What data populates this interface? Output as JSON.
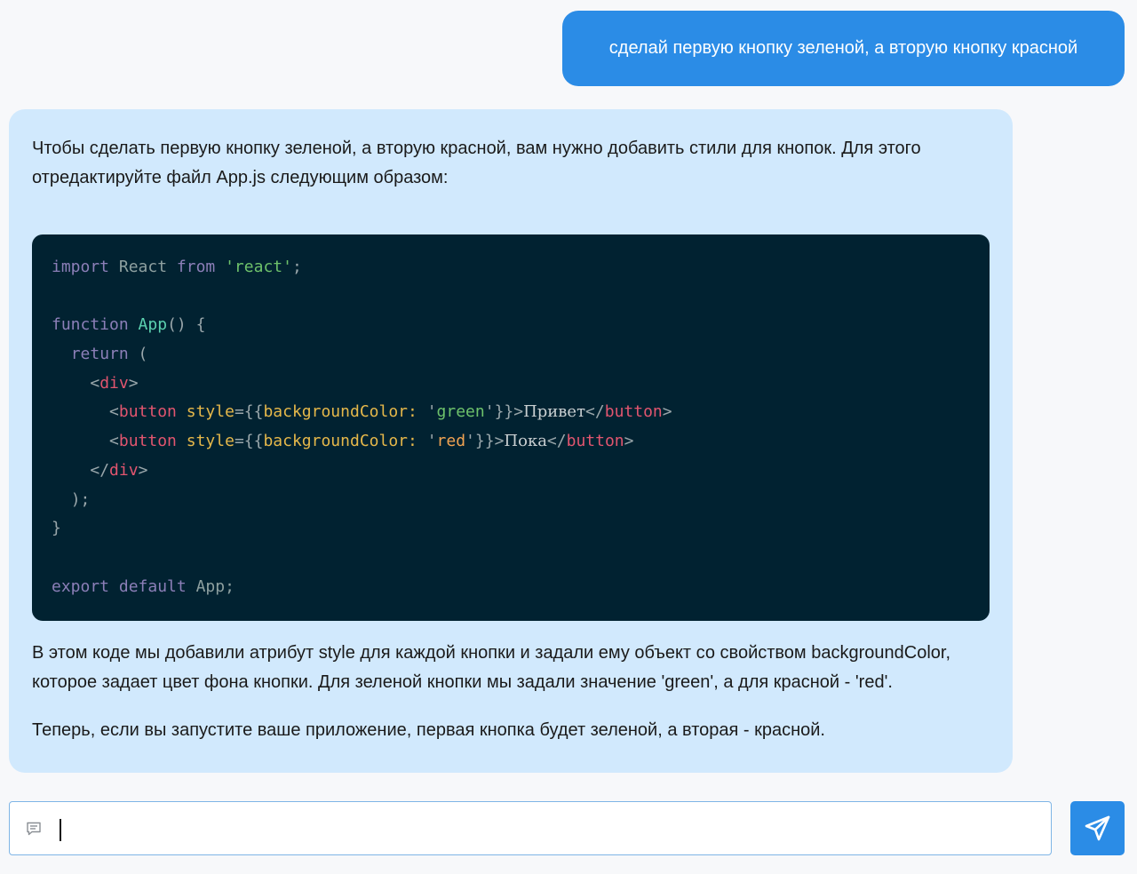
{
  "conversation": {
    "user_message": "сделай первую кнопку зеленой, а вторую кнопку красной",
    "assistant": {
      "intro": "Чтобы сделать первую кнопку зеленой, а вторую красной, вам нужно добавить стили для кнопок. Для этого отредактируйте файл App.js следующим образом:",
      "code": {
        "l1": {
          "kw": "import",
          "id": " React ",
          "kw2": "from",
          "sp": " ",
          "str": "'react'",
          "semi": ";"
        },
        "l3": {
          "kw": "function",
          "sp": " ",
          "fn": "App",
          "rest": "() {"
        },
        "l4": {
          "indent": "  ",
          "kw": "return",
          "rest": " ("
        },
        "l5": {
          "indent": "    ",
          "open": "<",
          "tag": "div",
          "close": ">"
        },
        "l6": {
          "indent": "      ",
          "open": "<",
          "tag": "button",
          "sp": " ",
          "attr": "style",
          "eq": "={{",
          "prop": "backgroundColor:",
          "sp2": " ",
          "q1": "'",
          "val": "green",
          "q2": "'",
          "end": "}}>",
          "text": "Привет",
          "ctag_open": "</",
          "ctag": "button",
          "ctag_close": ">"
        },
        "l7": {
          "indent": "      ",
          "open": "<",
          "tag": "button",
          "sp": " ",
          "attr": "style",
          "eq": "={{",
          "prop": "backgroundColor:",
          "sp2": " ",
          "q1": "'",
          "val": "red",
          "q2": "'",
          "end": "}}>",
          "text": "Пока",
          "ctag_open": "</",
          "ctag": "button",
          "ctag_close": ">"
        },
        "l8": {
          "indent": "    ",
          "open": "</",
          "tag": "div",
          "close": ">"
        },
        "l9": {
          "indent": "  ",
          "text": ");"
        },
        "l10": {
          "text": "}"
        },
        "l12": {
          "kw": "export",
          "sp": " ",
          "kw2": "default",
          "rest": " App;"
        }
      },
      "explanation": "В этом коде мы добавили атрибут style для каждой кнопки и задали ему объект со свойством backgroundColor, которое задает цвет фона кнопки. Для зеленой кнопки мы задали значение 'green', а для красной - 'red'.",
      "conclusion": "Теперь, если вы запустите ваше приложение, первая кнопка будет зеленой, а вторая - красной."
    }
  },
  "composer": {
    "placeholder": "",
    "value": "",
    "icon": "chat-bubble-icon",
    "send_icon": "send-plane-icon"
  },
  "colors": {
    "user_bubble": "#2b8ce6",
    "assistant_bubble": "#d1e9fd",
    "code_bg": "#012231",
    "send_button": "#2b8ce6"
  }
}
